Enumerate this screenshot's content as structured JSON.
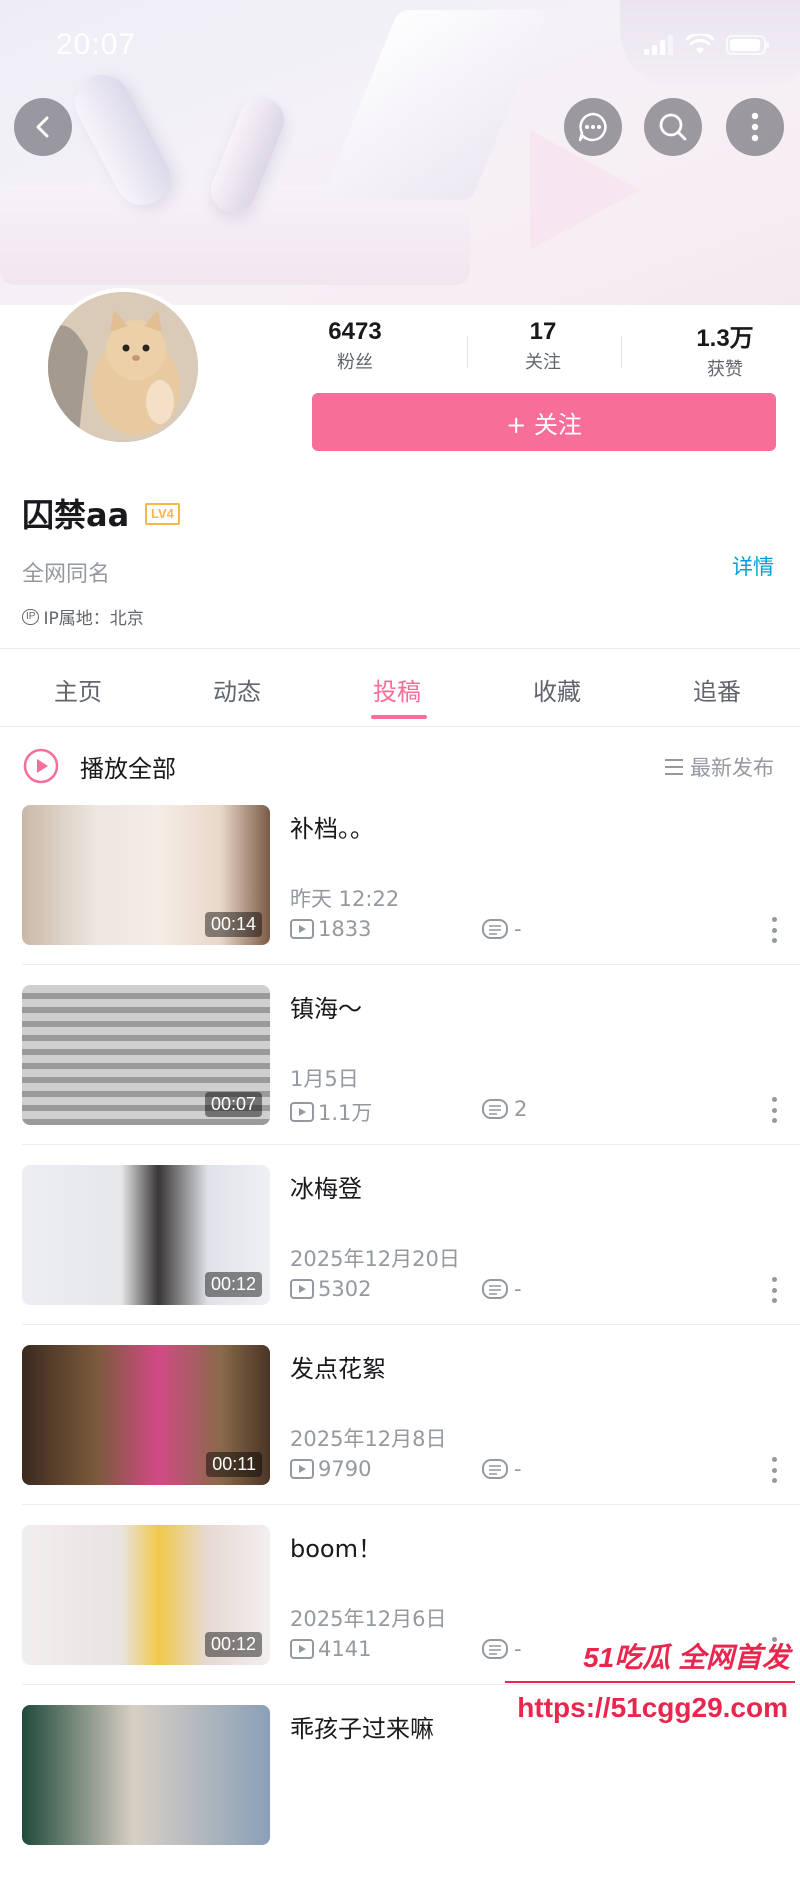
{
  "status_bar": {
    "time": "20:07"
  },
  "stats": [
    {
      "value": "6473",
      "label": "粉丝"
    },
    {
      "value": "17",
      "label": "关注"
    },
    {
      "value": "1.3万",
      "label": "获赞"
    }
  ],
  "follow_button": "+ 关注",
  "profile": {
    "username": "囚禁aa",
    "level": "LV4",
    "bio": "全网同名",
    "detail_link": "详情",
    "ip_badge": "IP",
    "ip_location": "IP属地：北京"
  },
  "tabs": [
    {
      "label": "主页",
      "active": false
    },
    {
      "label": "动态",
      "active": false
    },
    {
      "label": "投稿",
      "active": true
    },
    {
      "label": "收藏",
      "active": false
    },
    {
      "label": "追番",
      "active": false
    }
  ],
  "play_all": "播放全部",
  "sort": "最新发布",
  "videos": [
    {
      "title": "补档。。",
      "date": "昨天 12:22",
      "duration": "00:14",
      "plays": "1833",
      "danmaku": "-"
    },
    {
      "title": "镇海～",
      "date": "1月5日",
      "duration": "00:07",
      "plays": "1.1万",
      "danmaku": "2"
    },
    {
      "title": "冰梅登",
      "date": "2025年12月20日",
      "duration": "00:12",
      "plays": "5302",
      "danmaku": "-"
    },
    {
      "title": "发点花絮",
      "date": "2025年12月8日",
      "duration": "00:11",
      "plays": "9790",
      "danmaku": "-"
    },
    {
      "title": "boom！",
      "date": "2025年12月6日",
      "duration": "00:12",
      "plays": "4141",
      "danmaku": "-"
    },
    {
      "title": "乖孩子过来嘛"
    }
  ],
  "watermark": {
    "brand": "51吃瓜 全网首发",
    "url": "https://51cgg29.com"
  },
  "colors": {
    "accent": "#f76e99",
    "link": "#00a1d6",
    "level": "#f5b64a",
    "watermark": "#e8264e"
  }
}
